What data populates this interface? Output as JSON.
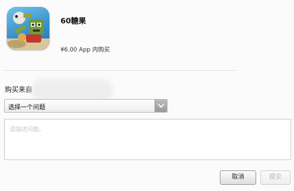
{
  "item": {
    "icon": "game-app-icon",
    "name": "60糖果",
    "price": "¥6.00 App 内购买"
  },
  "purchase": {
    "label": "购买来自"
  },
  "problem": {
    "selected": "选择一个问题",
    "arrow_icon": "chevron-down-icon"
  },
  "description": {
    "placeholder": "请描述问题。"
  },
  "actions": {
    "cancel_label": "取消",
    "submit_label": "提交"
  },
  "colors": {
    "divider": "#e3e3e3",
    "disabled_text": "#b0b0b0"
  }
}
